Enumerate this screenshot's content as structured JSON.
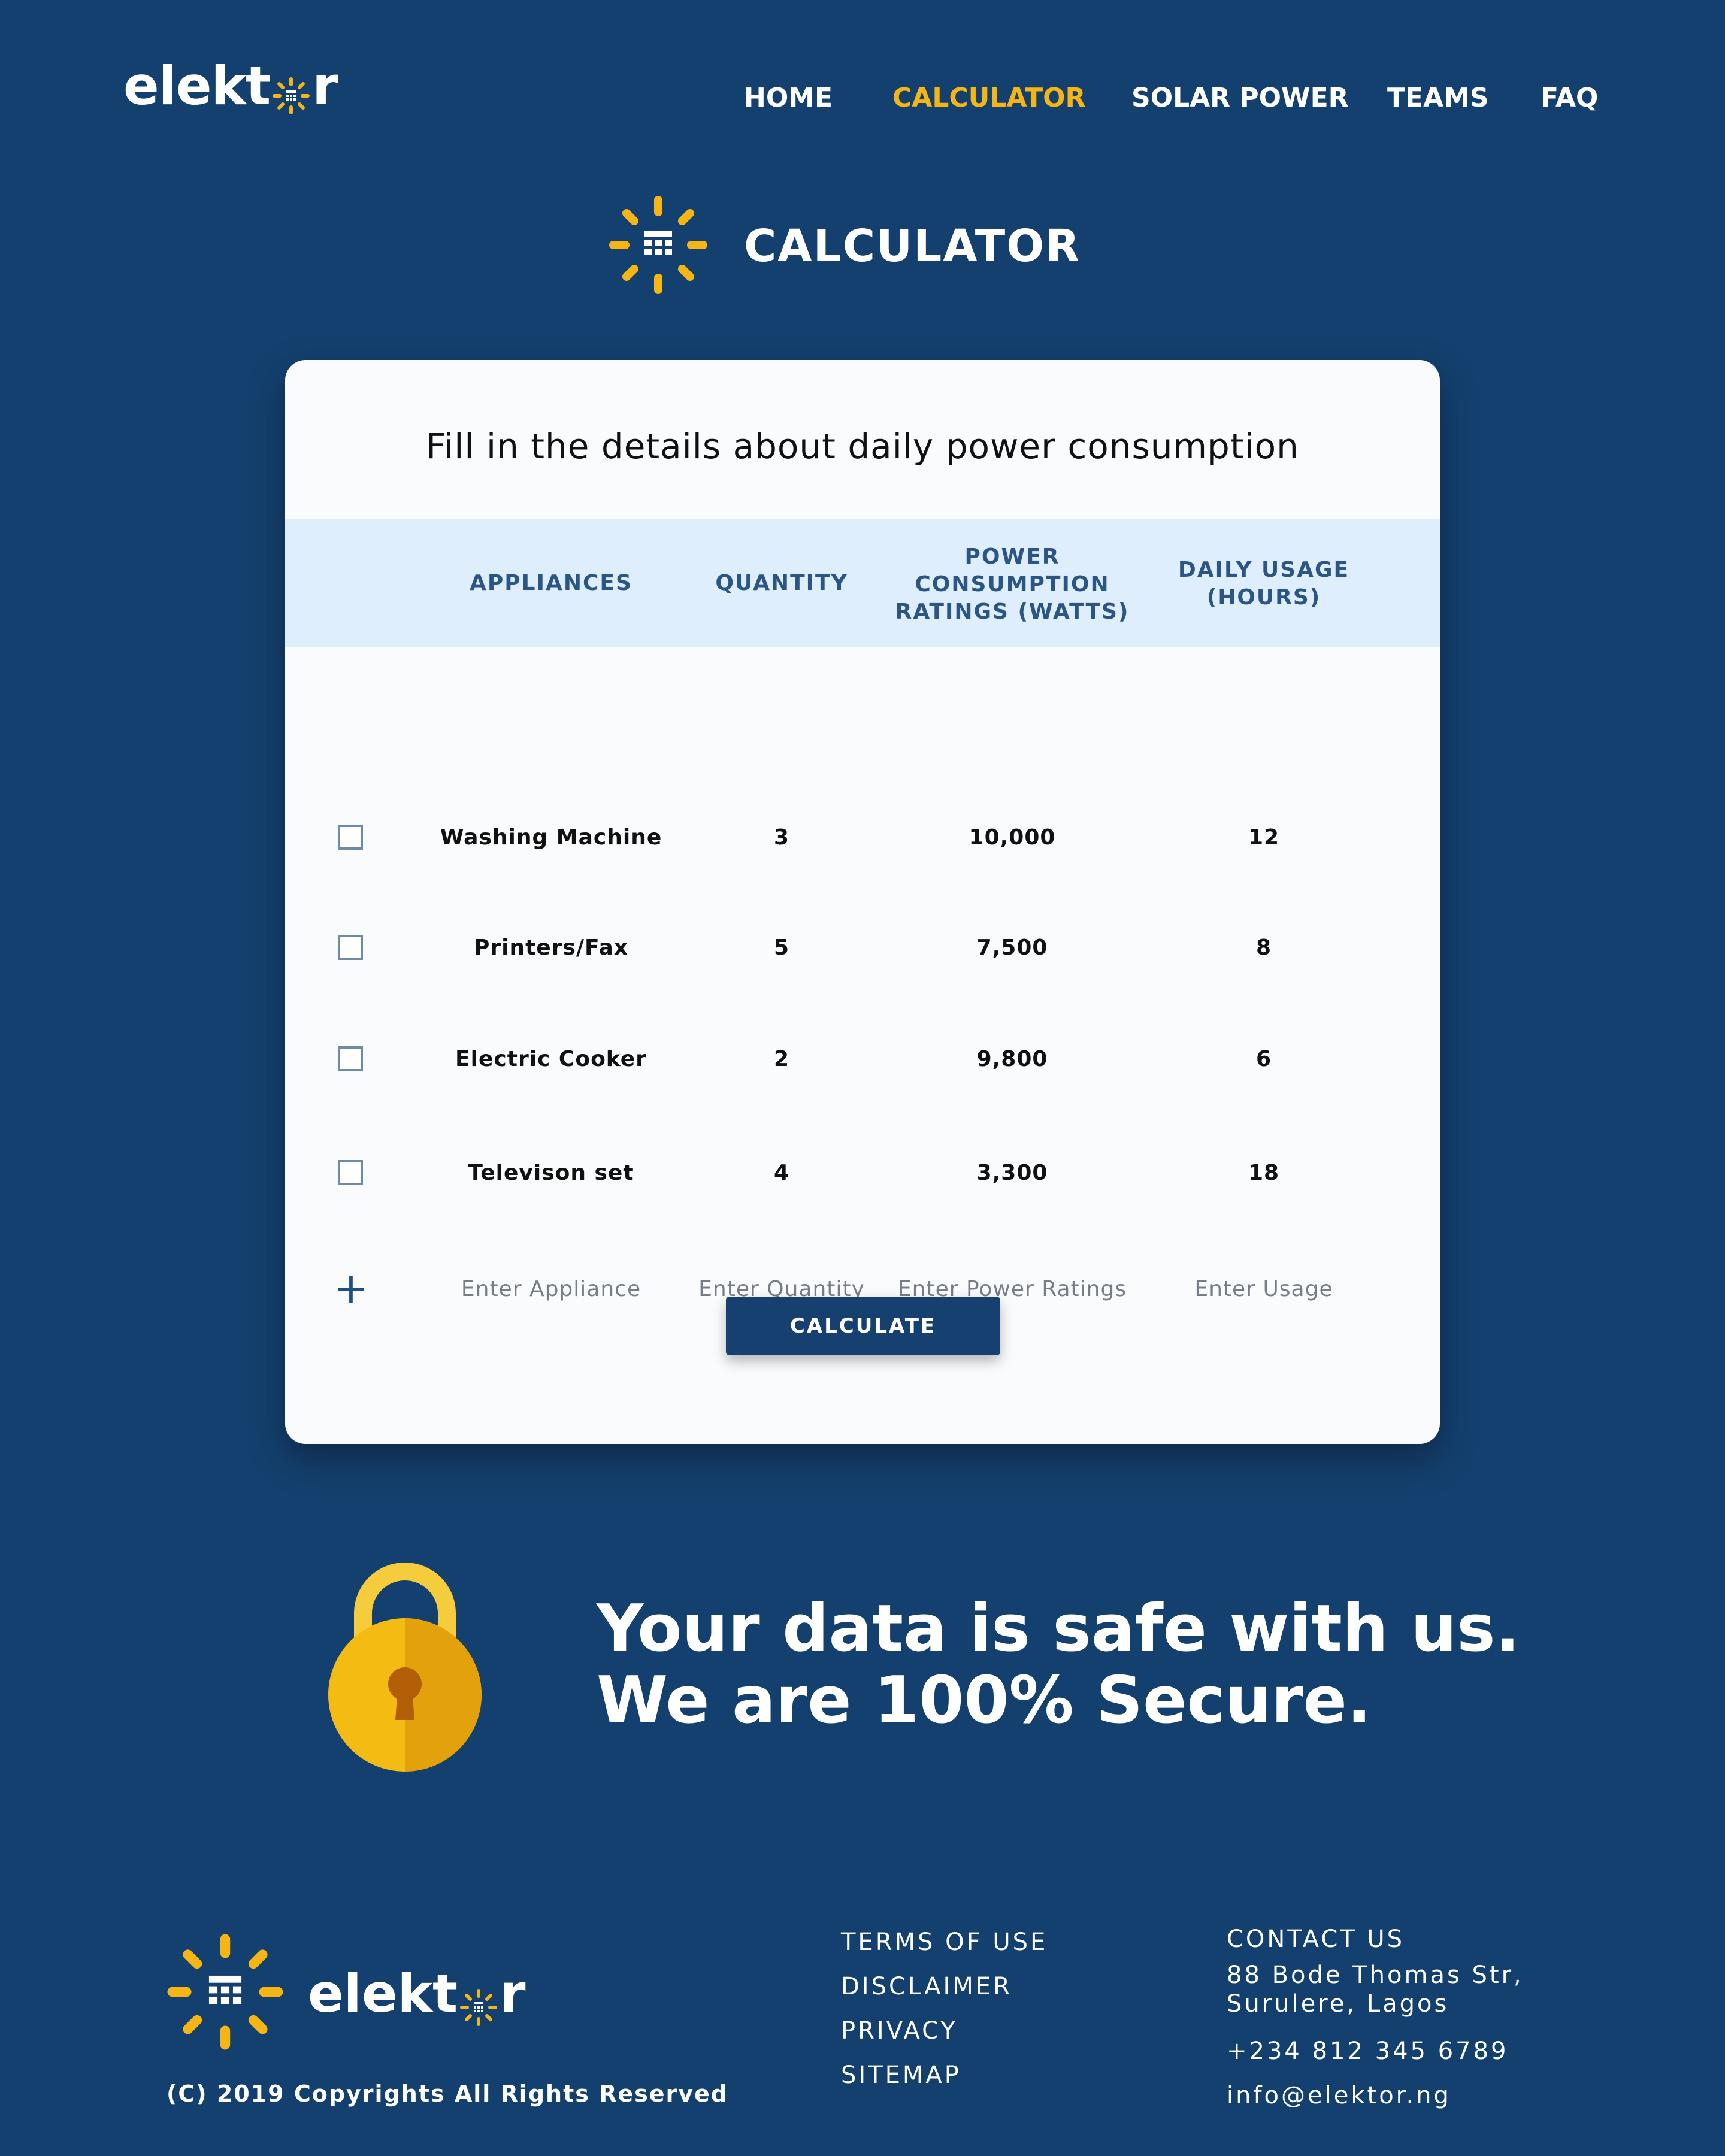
{
  "brand": {
    "name_before_icon": "elekt",
    "name_after_icon": "r",
    "accent_color": "#f5b514",
    "background_color": "#14406f"
  },
  "nav": {
    "items": [
      {
        "label": "HOME",
        "active": false
      },
      {
        "label": "CALCULATOR",
        "active": true
      },
      {
        "label": "SOLAR POWER",
        "active": false
      },
      {
        "label": "TEAMS",
        "active": false
      },
      {
        "label": "FAQ",
        "active": false
      }
    ]
  },
  "page": {
    "title": "CALCULATOR",
    "icon": "calculator-sun-icon"
  },
  "card": {
    "intro": "Fill in the details about daily power consumption",
    "headers": {
      "appliances": "APPLIANCES",
      "quantity": "QUANTITY",
      "power_line1": "POWER",
      "power_line2": "CONSUMPTION",
      "power_line3": "RATINGS (WATTS)",
      "usage_line1": "DAILY USAGE",
      "usage_line2": "(HOURS)"
    },
    "rows": [
      {
        "appliance": "Washing Machine",
        "quantity": "3",
        "power": "10,000",
        "usage": "12",
        "checked": false
      },
      {
        "appliance": "Printers/Fax",
        "quantity": "5",
        "power": "7,500",
        "usage": "8",
        "checked": false
      },
      {
        "appliance": "Electric Cooker",
        "quantity": "2",
        "power": "9,800",
        "usage": "6",
        "checked": false
      },
      {
        "appliance": "Televison set",
        "quantity": "4",
        "power": "3,300",
        "usage": "18",
        "checked": false
      }
    ],
    "new_row": {
      "appliance_placeholder": "Enter Appliance",
      "quantity_placeholder": "Enter Quantity",
      "power_placeholder": "Enter Power Ratings",
      "usage_placeholder": "Enter Usage"
    },
    "calculate_label": "CALCULATE"
  },
  "secure": {
    "line1": "Your data is safe with us.",
    "line2": "We are 100% Secure."
  },
  "footer": {
    "copyright": "(C) 2019 Copyrights All Rights Reserved",
    "links": [
      "TERMS OF USE",
      "DISCLAIMER",
      "PRIVACY",
      "SITEMAP"
    ],
    "contact_title": "CONTACT US",
    "address_line1": "88 Bode Thomas Str,",
    "address_line2": "Surulere, Lagos",
    "phone": "+234 812 345 6789",
    "email": "info@elektor.ng"
  }
}
